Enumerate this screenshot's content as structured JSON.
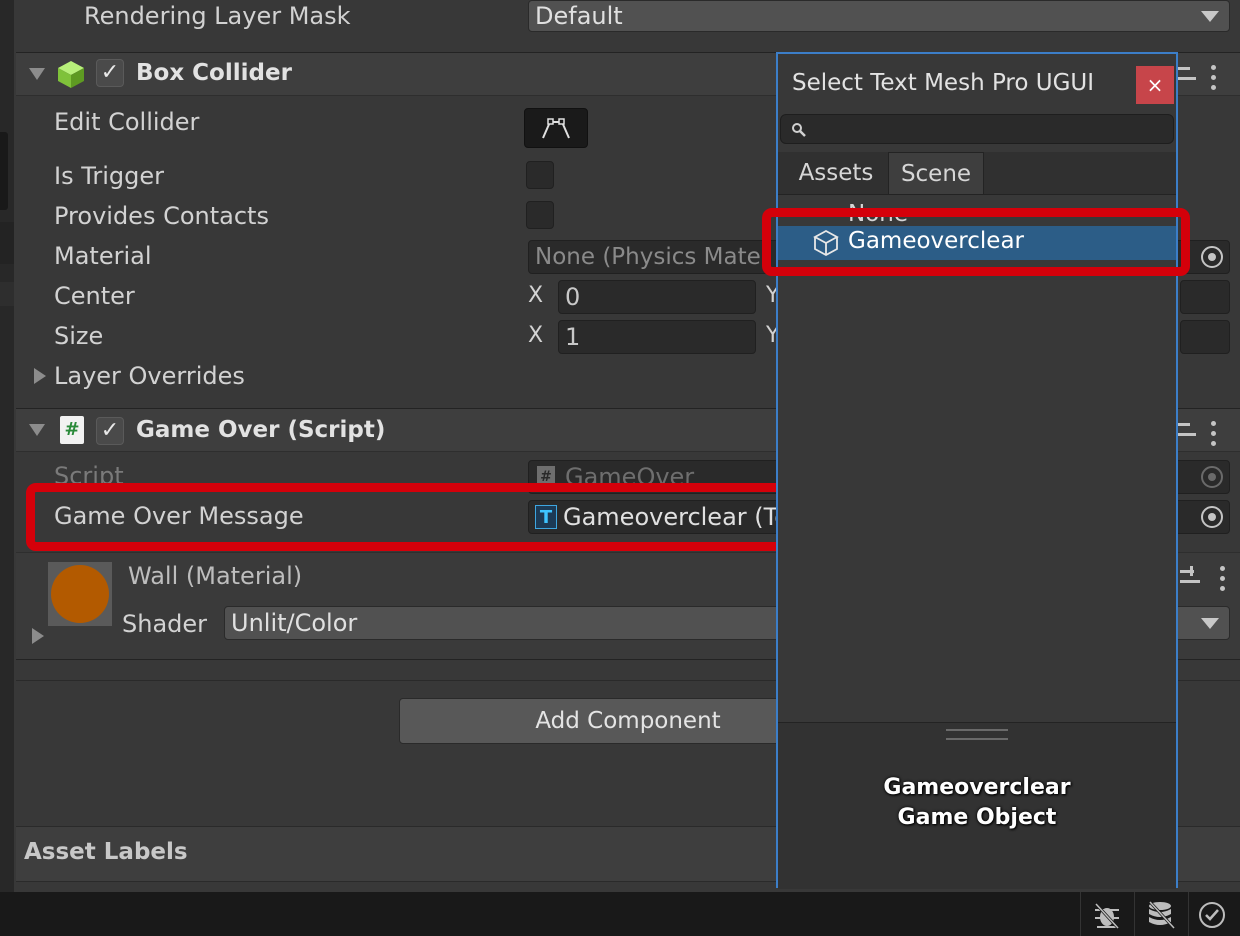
{
  "rendering_layer": {
    "label": "Rendering Layer Mask",
    "value": "Default"
  },
  "box_collider": {
    "title": "Box Collider",
    "edit_collider_label": "Edit Collider",
    "is_trigger_label": "Is Trigger",
    "provides_contacts_label": "Provides Contacts",
    "material_label": "Material",
    "material_value": "None (Physics Mate",
    "center_label": "Center",
    "center_x_label": "X",
    "center_x": "0",
    "center_y_label": "Y",
    "size_label": "Size",
    "size_x_label": "X",
    "size_x": "1",
    "size_y_label": "Y",
    "layer_overrides_label": "Layer Overrides"
  },
  "game_over_script": {
    "title": "Game Over (Script)",
    "script_label": "Script",
    "script_value": "GameOver",
    "message_label": "Game Over Message",
    "message_value": "Gameoverclear (Te"
  },
  "material": {
    "title": "Wall (Material)",
    "shader_label": "Shader",
    "shader_value": "Unlit/Color",
    "swatch_color": "#b35a00"
  },
  "add_component_label": "Add Component",
  "asset_labels_label": "Asset Labels",
  "popup": {
    "title": "Select Text Mesh Pro UGUI",
    "close_label": "×",
    "search_value": "",
    "tabs": [
      "Assets",
      "Scene"
    ],
    "active_tab": "Scene",
    "items": [
      "None",
      "Gameoverclear"
    ],
    "selected_item": "Gameoverclear",
    "preview_name": "Gameoverclear",
    "preview_type": "Game Object"
  },
  "colors": {
    "highlight": "#d4000a",
    "selection": "#2c5d87",
    "popup_border": "#3c7ec8",
    "close_button": "#c7454a"
  }
}
